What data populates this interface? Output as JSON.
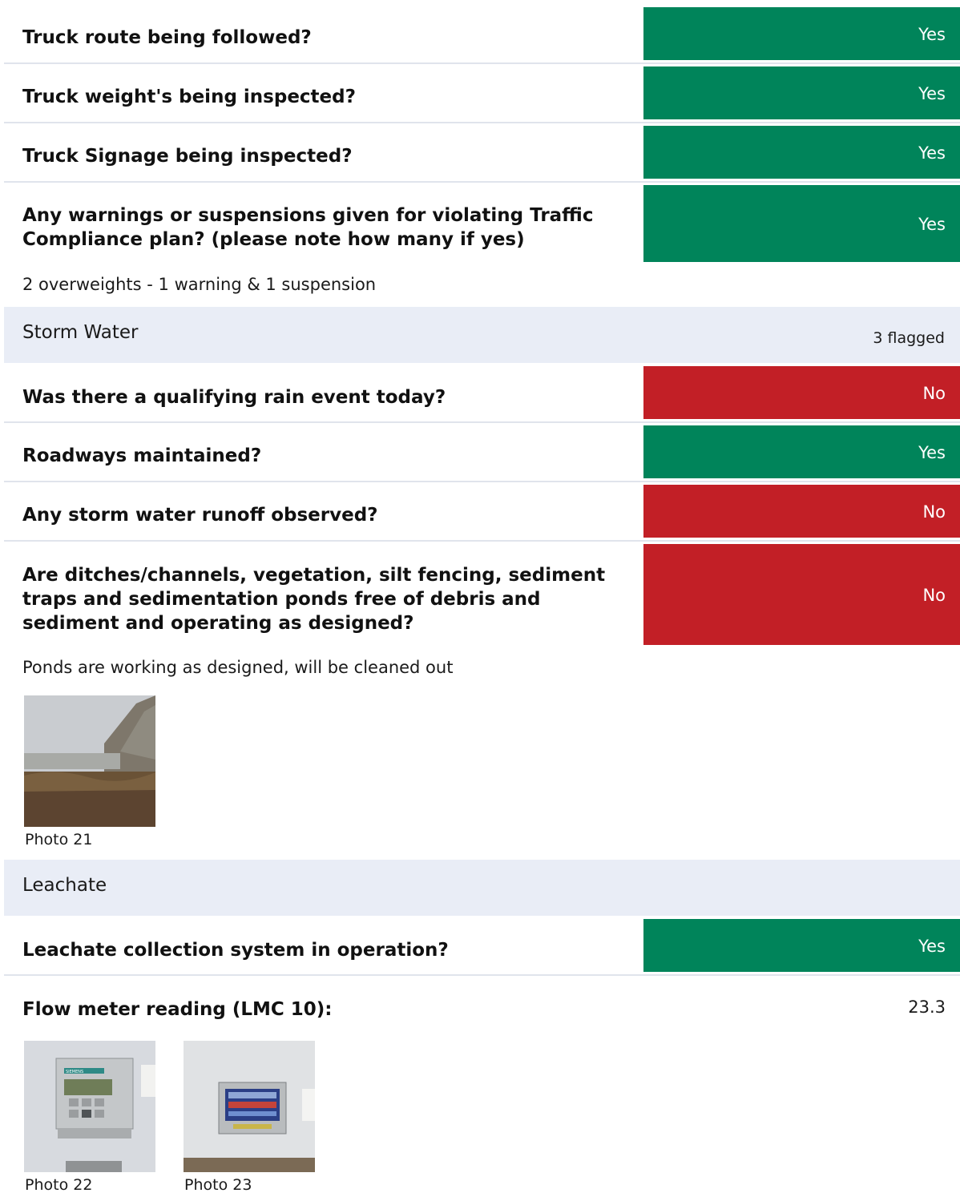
{
  "traffic": {
    "items": [
      {
        "question": "Truck route being followed?",
        "answer": "Yes"
      },
      {
        "question": "Truck weight's being inspected?",
        "answer": "Yes"
      },
      {
        "question": "Truck Signage being inspected?",
        "answer": "Yes"
      },
      {
        "question": "Any warnings or suspensions given for violating Traffic Compliance plan? (please note how many if yes)",
        "answer": "Yes",
        "note": "2 overweights - 1 warning & 1 suspension"
      }
    ]
  },
  "storm_water": {
    "title": "Storm Water",
    "flag_count": "3 flagged",
    "items": [
      {
        "question": "Was there a qualifying rain event today?",
        "answer": "No"
      },
      {
        "question": "Roadways maintained?",
        "answer": "Yes"
      },
      {
        "question": "Any storm water runoff observed?",
        "answer": "No"
      },
      {
        "question": "Are ditches/channels, vegetation, silt fencing, sediment traps and sedimentation ponds free of debris and sediment and operating as designed?",
        "answer": "No",
        "note": "Ponds are working as designed, will be cleaned out",
        "photos": [
          "Photo 21"
        ]
      }
    ]
  },
  "leachate": {
    "title": "Leachate",
    "items": [
      {
        "question": "Leachate collection system in operation?",
        "answer": "Yes"
      },
      {
        "question": "Flow meter reading (LMC 10):",
        "value": "23.3",
        "photos": [
          "Photo 22",
          "Photo 23"
        ]
      }
    ],
    "brand_text": "SIEMENS"
  },
  "colors": {
    "yes": "#00845a",
    "no": "#c21f26",
    "section_bg": "#e9edf6"
  }
}
